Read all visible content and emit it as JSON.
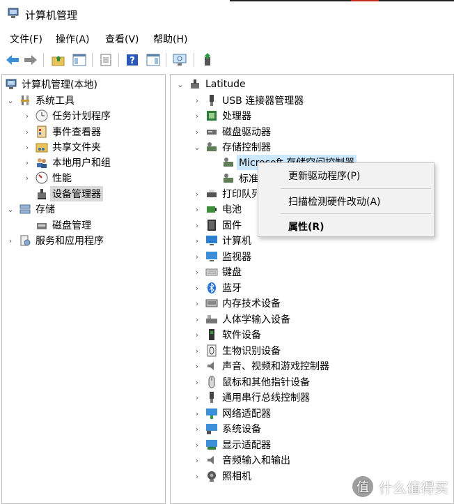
{
  "window": {
    "title": "计算机管理"
  },
  "menu": [
    "文件(F)",
    "操作(A)",
    "查看(V)",
    "帮助(H)"
  ],
  "left_tree": [
    {
      "label": "计算机管理(本地)",
      "icon": "computer-management-icon"
    },
    {
      "label": "系统工具",
      "icon": "tools-icon"
    },
    {
      "label": "任务计划程序",
      "icon": "clock-icon"
    },
    {
      "label": "事件查看器",
      "icon": "event-viewer-icon"
    },
    {
      "label": "共享文件夹",
      "icon": "shared-folder-icon"
    },
    {
      "label": "本地用户和组",
      "icon": "users-icon"
    },
    {
      "label": "性能",
      "icon": "performance-icon"
    },
    {
      "label": "设备管理器",
      "icon": "device-manager-icon"
    },
    {
      "label": "存储",
      "icon": "storage-icon"
    },
    {
      "label": "磁盘管理",
      "icon": "disk-management-icon"
    },
    {
      "label": "服务和应用程序",
      "icon": "services-icon"
    }
  ],
  "right_tree": {
    "root": "Latitude",
    "items": [
      "USB 连接器管理器",
      "处理器",
      "磁盘驱动器",
      "存储控制器",
      "Microsoft 存储空间控制器",
      "标准",
      "打印队列",
      "电池",
      "固件",
      "计算机",
      "监视器",
      "键盘",
      "蓝牙",
      "内存技术设备",
      "人体学输入设备",
      "软件设备",
      "生物识别设备",
      "声音、视频和游戏控制器",
      "鼠标和其他指针设备",
      "通用串行总线控制器",
      "网络适配器",
      "系统设备",
      "显示适配器",
      "音频输入和输出",
      "照相机"
    ]
  },
  "context_menu": {
    "update_driver": "更新驱动程序(P)",
    "scan_hardware": "扫描检测硬件改动(A)",
    "properties": "属性(R)"
  },
  "watermark": {
    "badge": "值",
    "text": "什么值得买"
  }
}
